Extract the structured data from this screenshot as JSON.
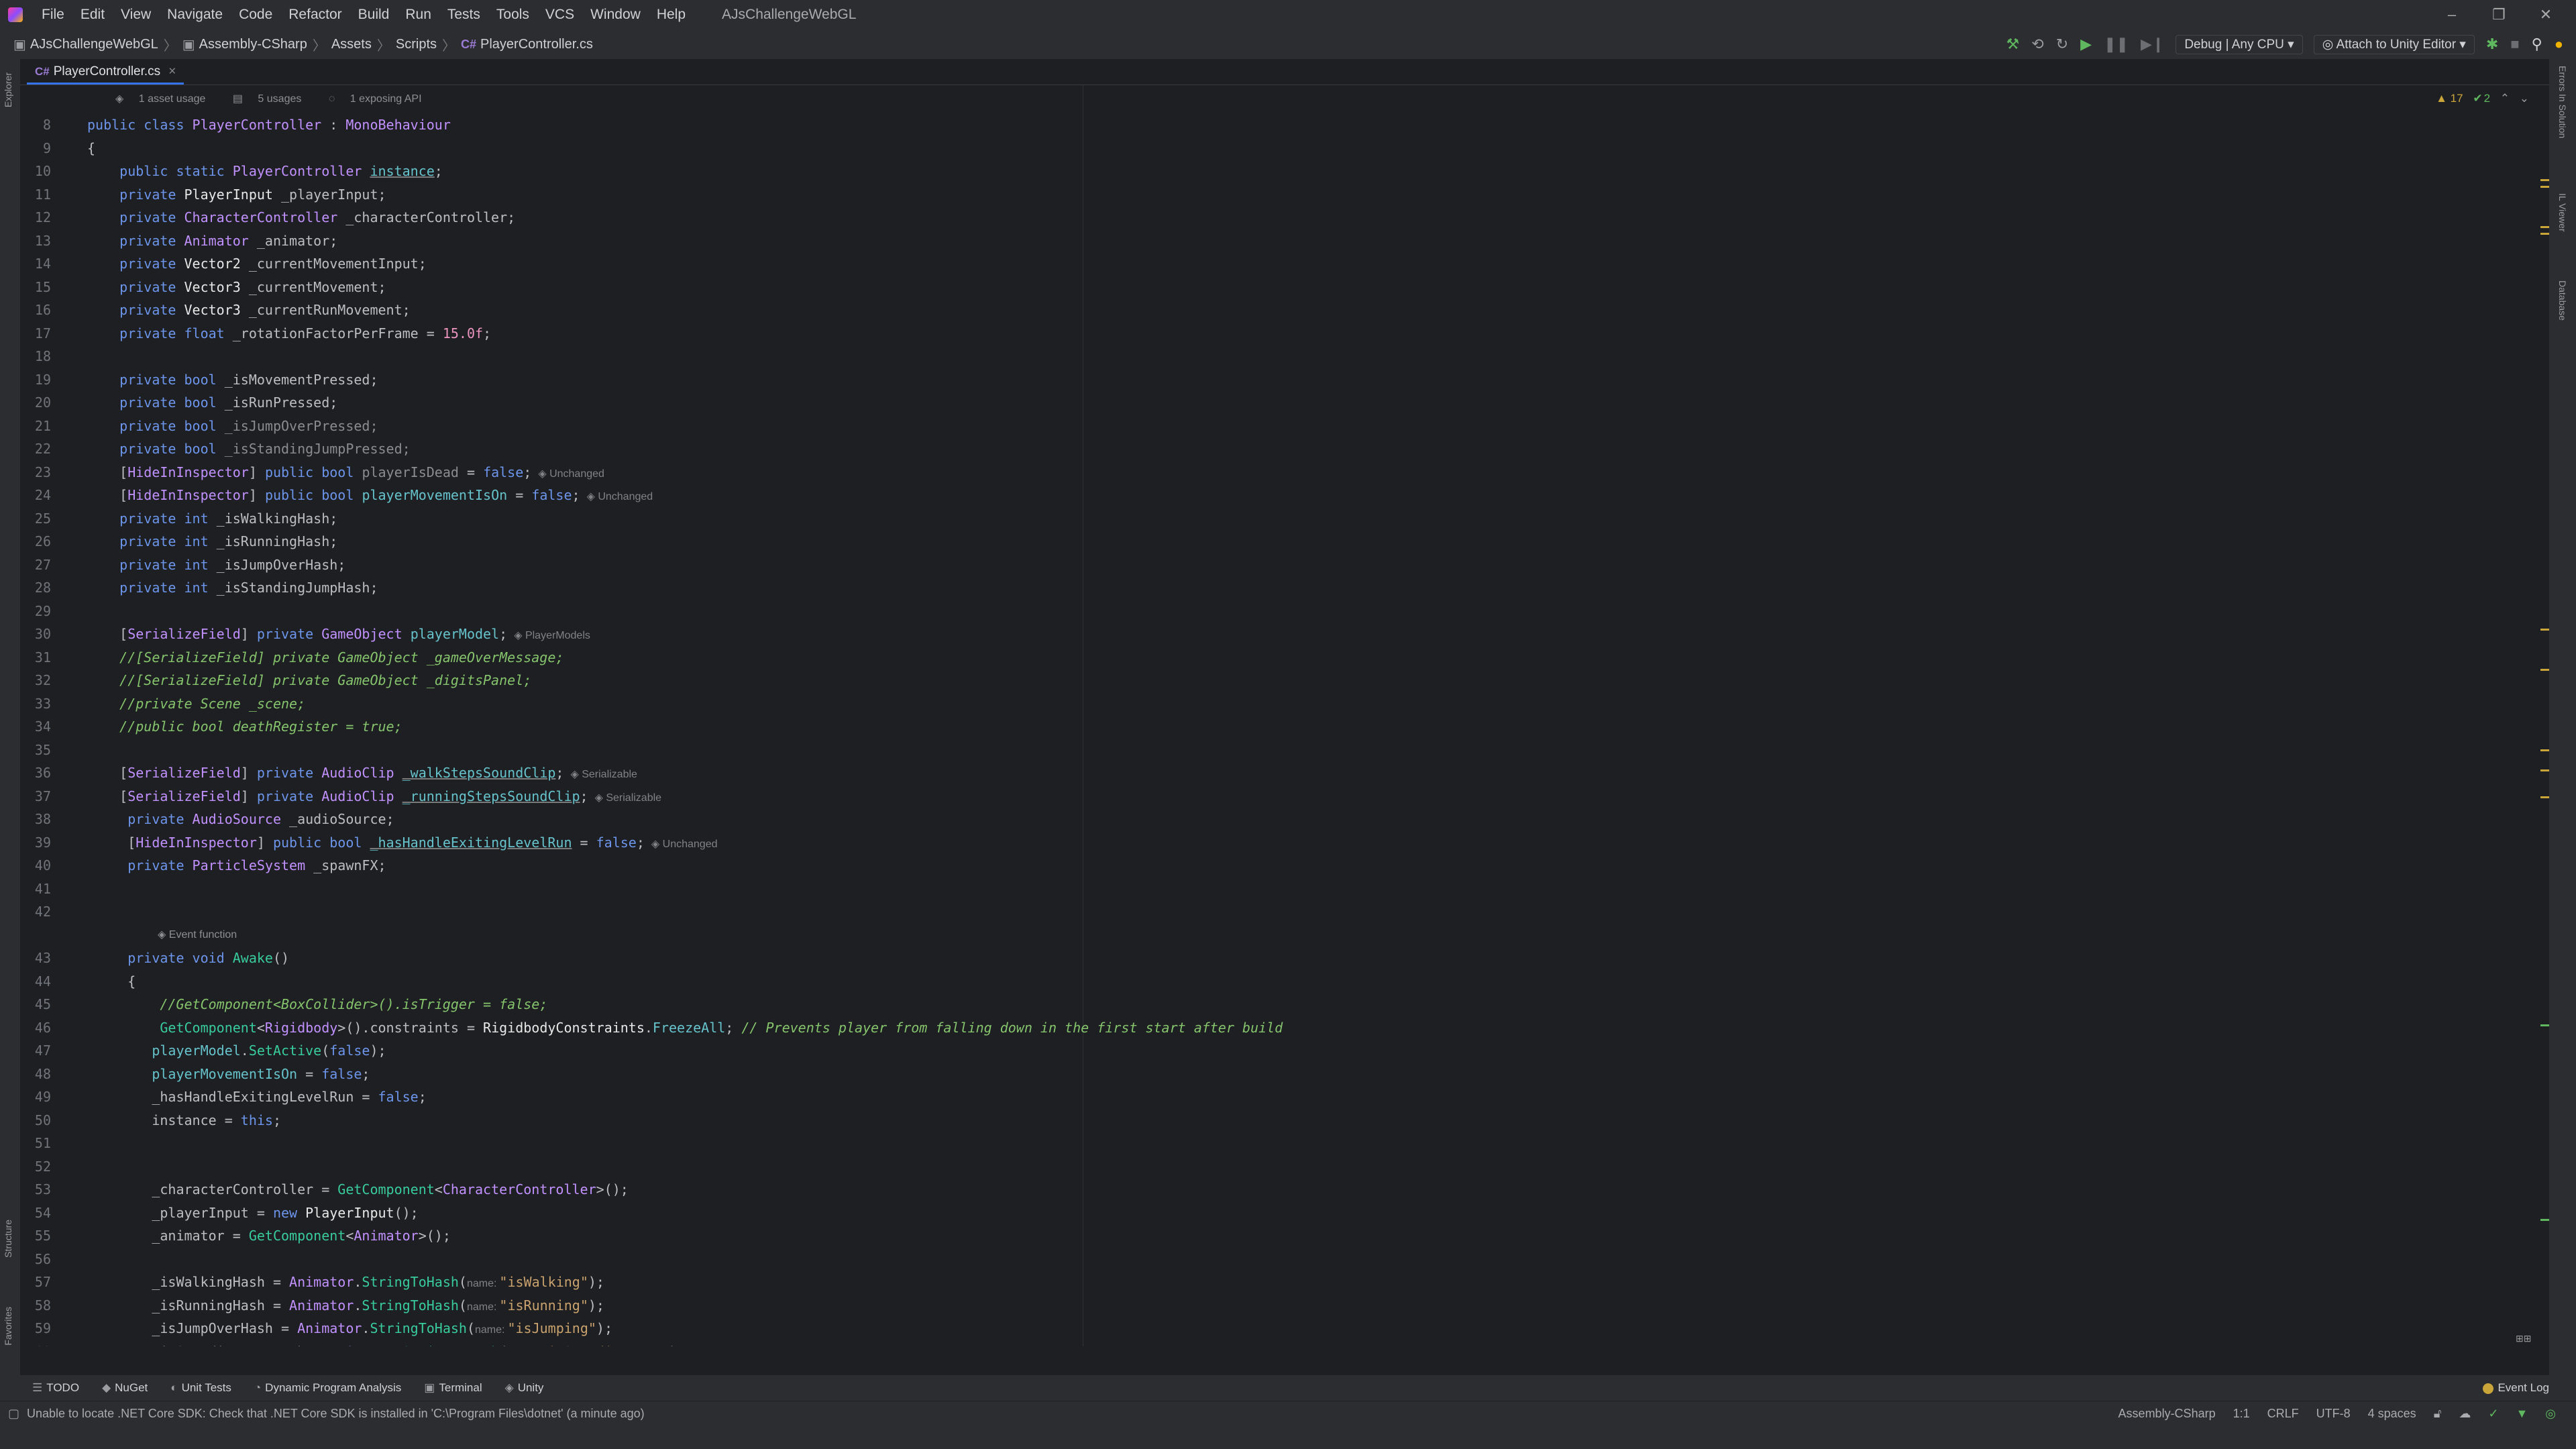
{
  "menubar": {
    "items": [
      "File",
      "Edit",
      "View",
      "Navigate",
      "Code",
      "Refactor",
      "Build",
      "Run",
      "Tests",
      "Tools",
      "VCS",
      "Window",
      "Help"
    ],
    "project_title": "AJsChallengeWebGL",
    "controls": [
      "–",
      "❐",
      "✕"
    ]
  },
  "navbar": {
    "breadcrumbs": [
      "AJsChallengeWebGL",
      "Assembly-CSharp",
      "Assets",
      "Scripts",
      "PlayerController.cs"
    ],
    "cs_badge": "C#",
    "config_label": "Debug | Any CPU",
    "attach_label": "Attach to Unity Editor"
  },
  "tab": {
    "label": "PlayerController.cs",
    "badge": "C#",
    "close": "×"
  },
  "left_strip": {
    "explorer": "Explorer",
    "structure": "Structure",
    "favorites": "Favorites"
  },
  "right_strip": {
    "errors": "Errors In Solution",
    "il_viewer": "IL Viewer",
    "database": "Database"
  },
  "editor": {
    "hints": [
      "1 asset usage",
      "5 usages",
      "1 exposing API"
    ],
    "warnings": "17",
    "oks": "2",
    "event_hint": "Event function"
  },
  "bottom_tabs": [
    "TODO",
    "NuGet",
    "Unit Tests",
    "Dynamic Program Analysis",
    "Terminal",
    "Unity"
  ],
  "event_log": "Event Log",
  "status": {
    "message": "Unable to locate .NET Core SDK: Check that .NET Core SDK is installed in 'C:\\Program Files\\dotnet' (a minute ago)",
    "right": [
      "Assembly-CSharp",
      "1:1",
      "CRLF",
      "UTF-8",
      "4 spaces"
    ]
  }
}
